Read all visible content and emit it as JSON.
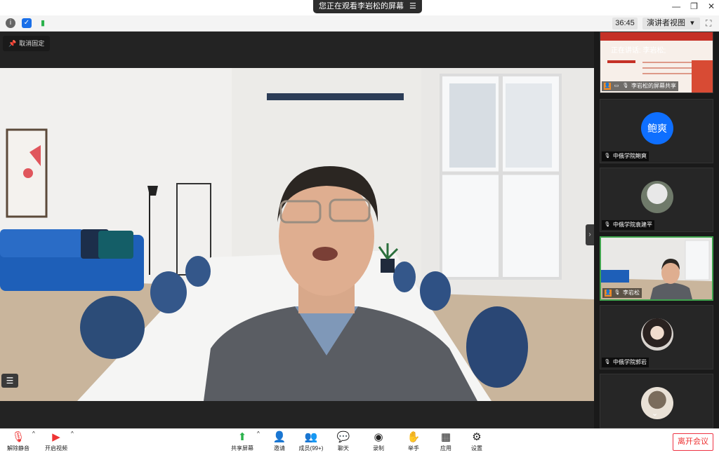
{
  "titlebar": {
    "share_notice": "您正在观看李岩松的屏幕",
    "menu_icon": "list-icon"
  },
  "subbar": {
    "timer": "36:45",
    "view_mode": "演讲者视图",
    "view_caret": "▾"
  },
  "stage": {
    "unpin_label": "取消固定"
  },
  "gallery": {
    "speaking_label": "正在讲话: 李岩松;",
    "tiles": [
      {
        "label": "李岩松的屏幕共享"
      },
      {
        "label": "中俄学院鲍爽",
        "avatar_text": "鲍爽"
      },
      {
        "label": "中俄学院袁建平"
      },
      {
        "label": "李岩松"
      },
      {
        "label": "中俄学院郭岩"
      }
    ]
  },
  "toolbar": {
    "unmute": "解除静音",
    "start_video": "开启视频",
    "share_screen": "共享屏幕",
    "invite": "邀请",
    "participants": "成员(99+)",
    "chat": "聊天",
    "record": "录制",
    "raise_hand": "举手",
    "apps": "应用",
    "settings": "设置",
    "leave": "离开会议"
  },
  "colors": {
    "accent_green": "#3fa34d",
    "avatar_blue": "#0e6fff",
    "leave_red": "#e33333"
  }
}
